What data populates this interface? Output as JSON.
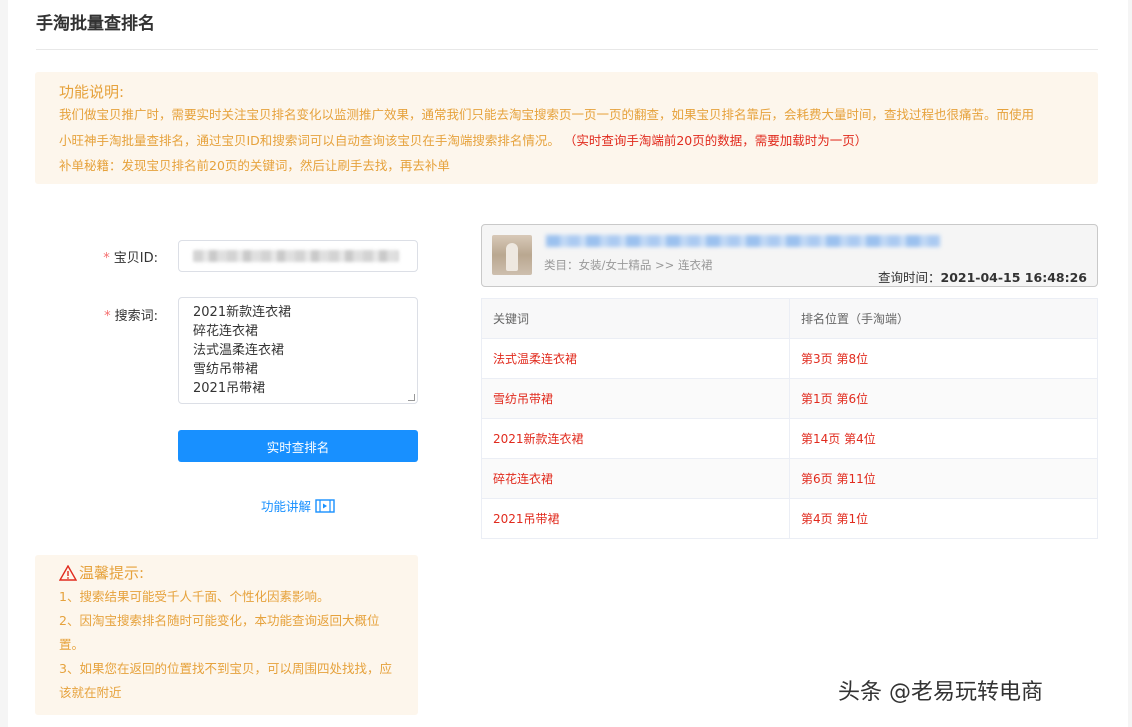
{
  "page": {
    "title": "手淘批量查排名"
  },
  "notice": {
    "title": "功能说明:",
    "body_line1": "我们做宝贝推广时，需要实时关注宝贝排名变化以监测推广效果，通常我们只能去淘宝搜索页一页一页的翻查，如果宝贝排名靠后，会耗费大量时间，查找过程也很痛苦。而使用",
    "body_line2": "小旺神手淘批量查排名，通过宝贝ID和搜索词可以自动查询该宝贝在手淘端搜索排名情况。",
    "body_red": "（实时查询手淘端前20页的数据，需要加载时为一页）",
    "tip": "补单秘籍：发现宝贝排名前20页的关键词，然后让刷手去找，再去补单"
  },
  "form": {
    "id_label": "宝贝ID:",
    "keywords_label": "搜索词:",
    "keywords": [
      "2021新款连衣裙",
      "碎花连衣裙",
      "法式温柔连衣裙",
      "雪纺吊带裙",
      "2021吊带裙"
    ],
    "submit_label": "实时查排名",
    "explain_label": "功能讲解"
  },
  "tips": {
    "title": "温馨提示:",
    "items": [
      "1、搜索结果可能受千人千面、个性化因素影响。",
      "2、因淘宝搜索排名随时可能变化，本功能查询返回大概位置。",
      "3、如果您在返回的位置找不到宝贝，可以周围四处找找，应该就在附近"
    ]
  },
  "product": {
    "category": "类目：女装/女士精品 >> 连衣裙",
    "query_time_label": "查询时间：",
    "query_time": "2021-04-15 16:48:26"
  },
  "results": {
    "headers": [
      "关键词",
      "排名位置（手淘端）"
    ],
    "rows": [
      {
        "keyword": "法式温柔连衣裙",
        "rank": "第3页 第8位"
      },
      {
        "keyword": "雪纺吊带裙",
        "rank": "第1页 第6位"
      },
      {
        "keyword": "2021新款连衣裙",
        "rank": "第14页 第4位"
      },
      {
        "keyword": "碎花连衣裙",
        "rank": "第6页 第11位"
      },
      {
        "keyword": "2021吊带裙",
        "rank": "第4页 第1位"
      }
    ]
  },
  "watermark": "头条 @老易玩转电商",
  "colors": {
    "accent": "#1890ff",
    "warning": "#e6a23c",
    "danger": "#e12b1e",
    "notice_bg": "#fdf6ec"
  }
}
